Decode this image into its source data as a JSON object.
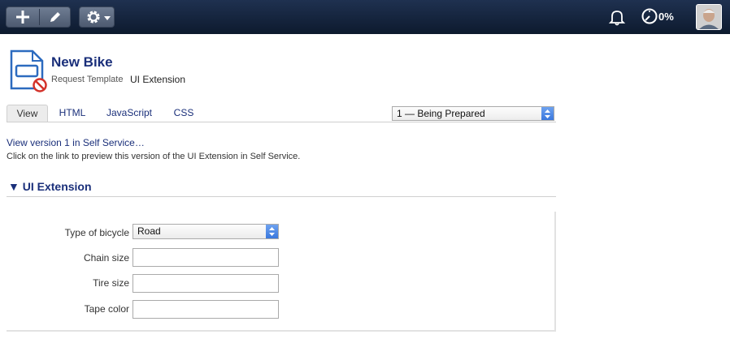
{
  "toolbar": {
    "add_icon": "plus-icon",
    "edit_icon": "pencil-icon",
    "settings_icon": "gear-icon",
    "notifications_icon": "bell-icon",
    "progress_icon": "gauge-icon",
    "progress_percent": "0%",
    "colors": {
      "bar": "#13223a",
      "button": "#5c6a80"
    }
  },
  "header": {
    "title": "New Bike",
    "type": "Request Template",
    "subtype": "UI Extension"
  },
  "tabs": [
    "View",
    "HTML",
    "JavaScript",
    "CSS"
  ],
  "status_select": {
    "selected": "1 — Being Prepared"
  },
  "preview": {
    "link": "View version 1 in Self Service…",
    "help": "Click on the link to preview this version of the UI Extension in Self Service."
  },
  "section": {
    "title": "▼ UI Extension"
  },
  "form": {
    "type_label": "Type of bicycle",
    "type_value": "Road",
    "chain_label": "Chain size",
    "chain_value": "",
    "tire_label": "Tire size",
    "tire_value": "",
    "tape_label": "Tape color",
    "tape_value": ""
  }
}
